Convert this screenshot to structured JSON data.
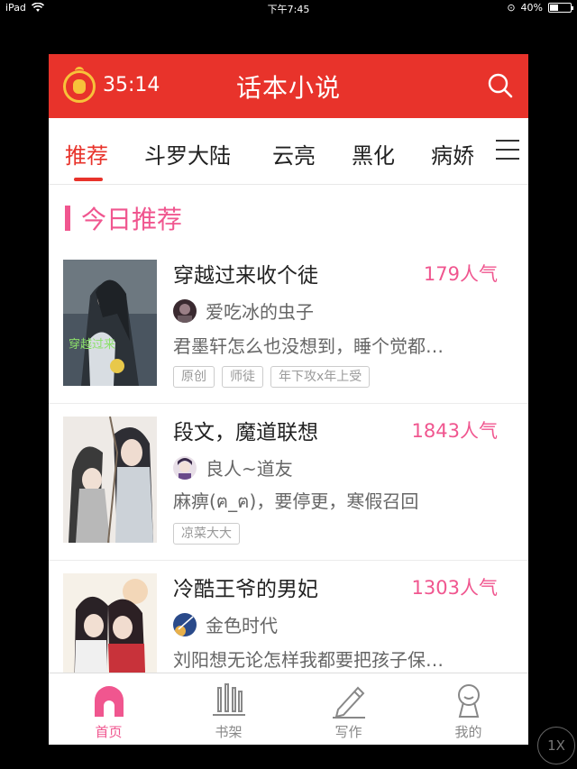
{
  "statusbar": {
    "device": "iPad",
    "time": "下午7:45",
    "battery": "40%",
    "battery_level": 0.4
  },
  "header": {
    "timer": "35:14",
    "title": "话本小说"
  },
  "tabs": [
    {
      "label": "推荐"
    },
    {
      "label": "斗罗大陆"
    },
    {
      "label": "云亮"
    },
    {
      "label": "黑化"
    },
    {
      "label": "病娇"
    }
  ],
  "section": {
    "title": "今日推荐"
  },
  "books": [
    {
      "title": "穿越过来收个徒",
      "popularity": "179人气",
      "author": "爱吃冰的虫子",
      "desc": "君墨轩怎么也没想到，睡个觉都…",
      "tags": [
        "原创",
        "师徒",
        "年下攻x年上受"
      ]
    },
    {
      "title": "段文，魔道联想",
      "popularity": "1843人气",
      "author": "良人~道友",
      "desc": "麻痹(ฅ_ฅ)，要停更，寒假召回",
      "tags": [
        "凉菜大大"
      ]
    },
    {
      "title": "冷酷王爷的男妃",
      "popularity": "1303人气",
      "author": "金色时代",
      "desc": "刘阳想无论怎样我都要把孩子保…",
      "tags": []
    }
  ],
  "nav": [
    {
      "label": "首页",
      "icon": "home-icon"
    },
    {
      "label": "书架",
      "icon": "bookshelf-icon"
    },
    {
      "label": "写作",
      "icon": "pen-icon"
    },
    {
      "label": "我的",
      "icon": "profile-icon"
    }
  ],
  "speed": "1X",
  "colors": {
    "brand_red": "#e8332b",
    "accent_pink": "#f0568f",
    "coin_gold": "#f7c23a"
  }
}
